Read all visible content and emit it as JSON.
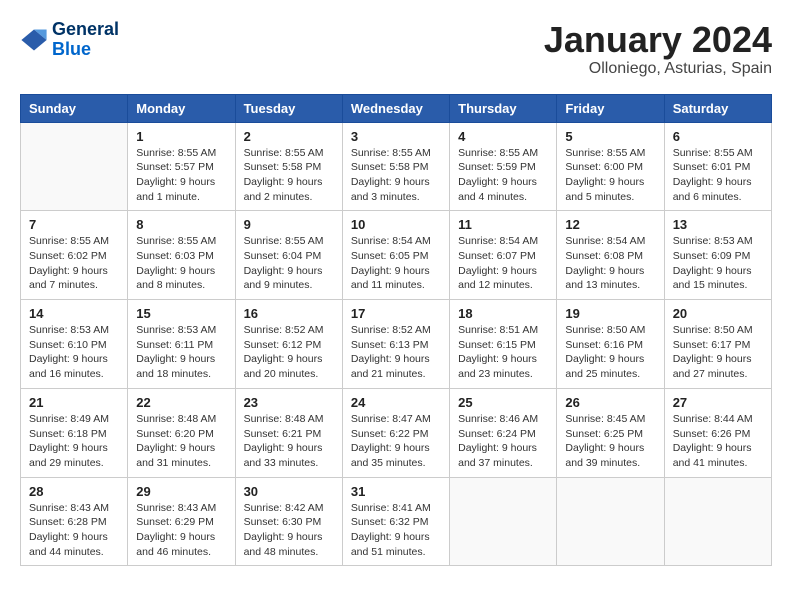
{
  "logo": {
    "line1": "General",
    "line2": "Blue"
  },
  "title": "January 2024",
  "location": "Olloniego, Asturias, Spain",
  "weekdays": [
    "Sunday",
    "Monday",
    "Tuesday",
    "Wednesday",
    "Thursday",
    "Friday",
    "Saturday"
  ],
  "weeks": [
    [
      {
        "day": "",
        "sunrise": "",
        "sunset": "",
        "daylight": ""
      },
      {
        "day": "1",
        "sunrise": "Sunrise: 8:55 AM",
        "sunset": "Sunset: 5:57 PM",
        "daylight": "Daylight: 9 hours and 1 minute."
      },
      {
        "day": "2",
        "sunrise": "Sunrise: 8:55 AM",
        "sunset": "Sunset: 5:58 PM",
        "daylight": "Daylight: 9 hours and 2 minutes."
      },
      {
        "day": "3",
        "sunrise": "Sunrise: 8:55 AM",
        "sunset": "Sunset: 5:58 PM",
        "daylight": "Daylight: 9 hours and 3 minutes."
      },
      {
        "day": "4",
        "sunrise": "Sunrise: 8:55 AM",
        "sunset": "Sunset: 5:59 PM",
        "daylight": "Daylight: 9 hours and 4 minutes."
      },
      {
        "day": "5",
        "sunrise": "Sunrise: 8:55 AM",
        "sunset": "Sunset: 6:00 PM",
        "daylight": "Daylight: 9 hours and 5 minutes."
      },
      {
        "day": "6",
        "sunrise": "Sunrise: 8:55 AM",
        "sunset": "Sunset: 6:01 PM",
        "daylight": "Daylight: 9 hours and 6 minutes."
      }
    ],
    [
      {
        "day": "7",
        "sunrise": "Sunrise: 8:55 AM",
        "sunset": "Sunset: 6:02 PM",
        "daylight": "Daylight: 9 hours and 7 minutes."
      },
      {
        "day": "8",
        "sunrise": "Sunrise: 8:55 AM",
        "sunset": "Sunset: 6:03 PM",
        "daylight": "Daylight: 9 hours and 8 minutes."
      },
      {
        "day": "9",
        "sunrise": "Sunrise: 8:55 AM",
        "sunset": "Sunset: 6:04 PM",
        "daylight": "Daylight: 9 hours and 9 minutes."
      },
      {
        "day": "10",
        "sunrise": "Sunrise: 8:54 AM",
        "sunset": "Sunset: 6:05 PM",
        "daylight": "Daylight: 9 hours and 11 minutes."
      },
      {
        "day": "11",
        "sunrise": "Sunrise: 8:54 AM",
        "sunset": "Sunset: 6:07 PM",
        "daylight": "Daylight: 9 hours and 12 minutes."
      },
      {
        "day": "12",
        "sunrise": "Sunrise: 8:54 AM",
        "sunset": "Sunset: 6:08 PM",
        "daylight": "Daylight: 9 hours and 13 minutes."
      },
      {
        "day": "13",
        "sunrise": "Sunrise: 8:53 AM",
        "sunset": "Sunset: 6:09 PM",
        "daylight": "Daylight: 9 hours and 15 minutes."
      }
    ],
    [
      {
        "day": "14",
        "sunrise": "Sunrise: 8:53 AM",
        "sunset": "Sunset: 6:10 PM",
        "daylight": "Daylight: 9 hours and 16 minutes."
      },
      {
        "day": "15",
        "sunrise": "Sunrise: 8:53 AM",
        "sunset": "Sunset: 6:11 PM",
        "daylight": "Daylight: 9 hours and 18 minutes."
      },
      {
        "day": "16",
        "sunrise": "Sunrise: 8:52 AM",
        "sunset": "Sunset: 6:12 PM",
        "daylight": "Daylight: 9 hours and 20 minutes."
      },
      {
        "day": "17",
        "sunrise": "Sunrise: 8:52 AM",
        "sunset": "Sunset: 6:13 PM",
        "daylight": "Daylight: 9 hours and 21 minutes."
      },
      {
        "day": "18",
        "sunrise": "Sunrise: 8:51 AM",
        "sunset": "Sunset: 6:15 PM",
        "daylight": "Daylight: 9 hours and 23 minutes."
      },
      {
        "day": "19",
        "sunrise": "Sunrise: 8:50 AM",
        "sunset": "Sunset: 6:16 PM",
        "daylight": "Daylight: 9 hours and 25 minutes."
      },
      {
        "day": "20",
        "sunrise": "Sunrise: 8:50 AM",
        "sunset": "Sunset: 6:17 PM",
        "daylight": "Daylight: 9 hours and 27 minutes."
      }
    ],
    [
      {
        "day": "21",
        "sunrise": "Sunrise: 8:49 AM",
        "sunset": "Sunset: 6:18 PM",
        "daylight": "Daylight: 9 hours and 29 minutes."
      },
      {
        "day": "22",
        "sunrise": "Sunrise: 8:48 AM",
        "sunset": "Sunset: 6:20 PM",
        "daylight": "Daylight: 9 hours and 31 minutes."
      },
      {
        "day": "23",
        "sunrise": "Sunrise: 8:48 AM",
        "sunset": "Sunset: 6:21 PM",
        "daylight": "Daylight: 9 hours and 33 minutes."
      },
      {
        "day": "24",
        "sunrise": "Sunrise: 8:47 AM",
        "sunset": "Sunset: 6:22 PM",
        "daylight": "Daylight: 9 hours and 35 minutes."
      },
      {
        "day": "25",
        "sunrise": "Sunrise: 8:46 AM",
        "sunset": "Sunset: 6:24 PM",
        "daylight": "Daylight: 9 hours and 37 minutes."
      },
      {
        "day": "26",
        "sunrise": "Sunrise: 8:45 AM",
        "sunset": "Sunset: 6:25 PM",
        "daylight": "Daylight: 9 hours and 39 minutes."
      },
      {
        "day": "27",
        "sunrise": "Sunrise: 8:44 AM",
        "sunset": "Sunset: 6:26 PM",
        "daylight": "Daylight: 9 hours and 41 minutes."
      }
    ],
    [
      {
        "day": "28",
        "sunrise": "Sunrise: 8:43 AM",
        "sunset": "Sunset: 6:28 PM",
        "daylight": "Daylight: 9 hours and 44 minutes."
      },
      {
        "day": "29",
        "sunrise": "Sunrise: 8:43 AM",
        "sunset": "Sunset: 6:29 PM",
        "daylight": "Daylight: 9 hours and 46 minutes."
      },
      {
        "day": "30",
        "sunrise": "Sunrise: 8:42 AM",
        "sunset": "Sunset: 6:30 PM",
        "daylight": "Daylight: 9 hours and 48 minutes."
      },
      {
        "day": "31",
        "sunrise": "Sunrise: 8:41 AM",
        "sunset": "Sunset: 6:32 PM",
        "daylight": "Daylight: 9 hours and 51 minutes."
      },
      {
        "day": "",
        "sunrise": "",
        "sunset": "",
        "daylight": ""
      },
      {
        "day": "",
        "sunrise": "",
        "sunset": "",
        "daylight": ""
      },
      {
        "day": "",
        "sunrise": "",
        "sunset": "",
        "daylight": ""
      }
    ]
  ]
}
